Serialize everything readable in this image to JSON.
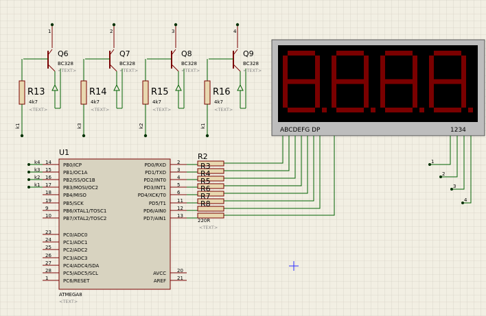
{
  "transistors": [
    {
      "ref": "Q6",
      "type": "BC328",
      "text": "<TEXT>",
      "pin": "1"
    },
    {
      "ref": "Q7",
      "type": "BC328",
      "text": "<TEXT>",
      "pin": "2"
    },
    {
      "ref": "Q8",
      "type": "BC328",
      "text": "<TEXT>",
      "pin": "3"
    },
    {
      "ref": "Q9",
      "type": "BC328",
      "text": "<TEXT>",
      "pin": "4"
    }
  ],
  "base_resistors": [
    {
      "ref": "R13",
      "value": "4k7",
      "text": "<TEXT>",
      "net": "k1"
    },
    {
      "ref": "R14",
      "value": "4k7",
      "text": "<TEXT>",
      "net": "k3"
    },
    {
      "ref": "R15",
      "value": "4k7",
      "text": "<TEXT>",
      "net": "k2"
    },
    {
      "ref": "R16",
      "value": "4k7",
      "text": "<TEXT>",
      "net": "k1"
    }
  ],
  "display": {
    "segment_label": "ABCDEFG  DP",
    "digit_label": "1234",
    "color": "#7a0000",
    "digits": 4
  },
  "mcu": {
    "ref": "U1",
    "part": "ATMEGA8",
    "text": "<TEXT>",
    "left_pins": [
      {
        "num": "14",
        "name": "PB0/ICP",
        "net": "k4"
      },
      {
        "num": "15",
        "name": "PB1/OC1A",
        "net": "k3"
      },
      {
        "num": "16",
        "name": "PB2/SS/OC1B",
        "net": "k2"
      },
      {
        "num": "17",
        "name": "PB3/MOSI/OC2",
        "net": "k1"
      },
      {
        "num": "18",
        "name": "PB4/MISO",
        "net": ""
      },
      {
        "num": "19",
        "name": "PB5/SCK",
        "net": ""
      },
      {
        "num": "9",
        "name": "PB6/XTAL1/TOSC1",
        "net": ""
      },
      {
        "num": "10",
        "name": "PB7/XTAL2/TOSC2",
        "net": ""
      },
      {
        "num": "23",
        "name": "PC0/ADC0",
        "net": ""
      },
      {
        "num": "24",
        "name": "PC1/ADC1",
        "net": ""
      },
      {
        "num": "25",
        "name": "PC2/ADC2",
        "net": ""
      },
      {
        "num": "26",
        "name": "PC3/ADC3",
        "net": ""
      },
      {
        "num": "27",
        "name": "PC4/ADC4/SDA",
        "net": ""
      },
      {
        "num": "28",
        "name": "PC5/ADC5/SCL",
        "net": ""
      },
      {
        "num": "1",
        "name": "PC6/RESET",
        "net": ""
      }
    ],
    "right_pins": [
      {
        "num": "2",
        "name": "PD0/RXD"
      },
      {
        "num": "3",
        "name": "PD1/TXD"
      },
      {
        "num": "4",
        "name": "PD2/INT0"
      },
      {
        "num": "5",
        "name": "PD3/INT1"
      },
      {
        "num": "6",
        "name": "PD4/XCK/T0"
      },
      {
        "num": "11",
        "name": "PD5/T1"
      },
      {
        "num": "12",
        "name": "PD6/AIN0"
      },
      {
        "num": "13",
        "name": "PD7/AIN1"
      },
      {
        "num": "20",
        "name": "AVCC"
      },
      {
        "num": "21",
        "name": "AREF"
      }
    ]
  },
  "resistor_pack": {
    "ref": "R2",
    "refs": [
      "R3",
      "R4",
      "R5",
      "R6",
      "R7",
      "R8"
    ],
    "value": "220R",
    "text": "<TEXT>"
  },
  "digit_nets": [
    "1",
    "2",
    "3",
    "4"
  ]
}
